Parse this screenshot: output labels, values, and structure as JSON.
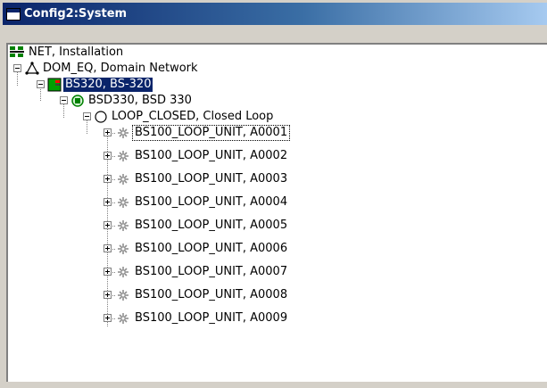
{
  "window": {
    "title": "Config2:System"
  },
  "tree": {
    "root": {
      "label": "NET, Installation",
      "icon": "network-icon"
    },
    "domain": {
      "label": "DOM_EQ, Domain Network",
      "icon": "domain-icon"
    },
    "controller": {
      "label": "BS320, BS-320",
      "icon": "controller-icon"
    },
    "bsd": {
      "label": "BSD330, BSD 330",
      "icon": "bsd-icon"
    },
    "loop": {
      "label": "LOOP_CLOSED, Closed Loop",
      "icon": "loop-icon"
    },
    "units": [
      {
        "label": "BS100_LOOP_UNIT, A0001"
      },
      {
        "label": "BS100_LOOP_UNIT, A0002"
      },
      {
        "label": "BS100_LOOP_UNIT, A0003"
      },
      {
        "label": "BS100_LOOP_UNIT, A0004"
      },
      {
        "label": "BS100_LOOP_UNIT, A0005"
      },
      {
        "label": "BS100_LOOP_UNIT, A0006"
      },
      {
        "label": "BS100_LOOP_UNIT, A0007"
      },
      {
        "label": "BS100_LOOP_UNIT, A0008"
      },
      {
        "label": "BS100_LOOP_UNIT, A0009"
      }
    ]
  },
  "colors": {
    "selection": "#0a246a",
    "title_gradient_start": "#0a246a",
    "title_gradient_end": "#a6caf0"
  }
}
